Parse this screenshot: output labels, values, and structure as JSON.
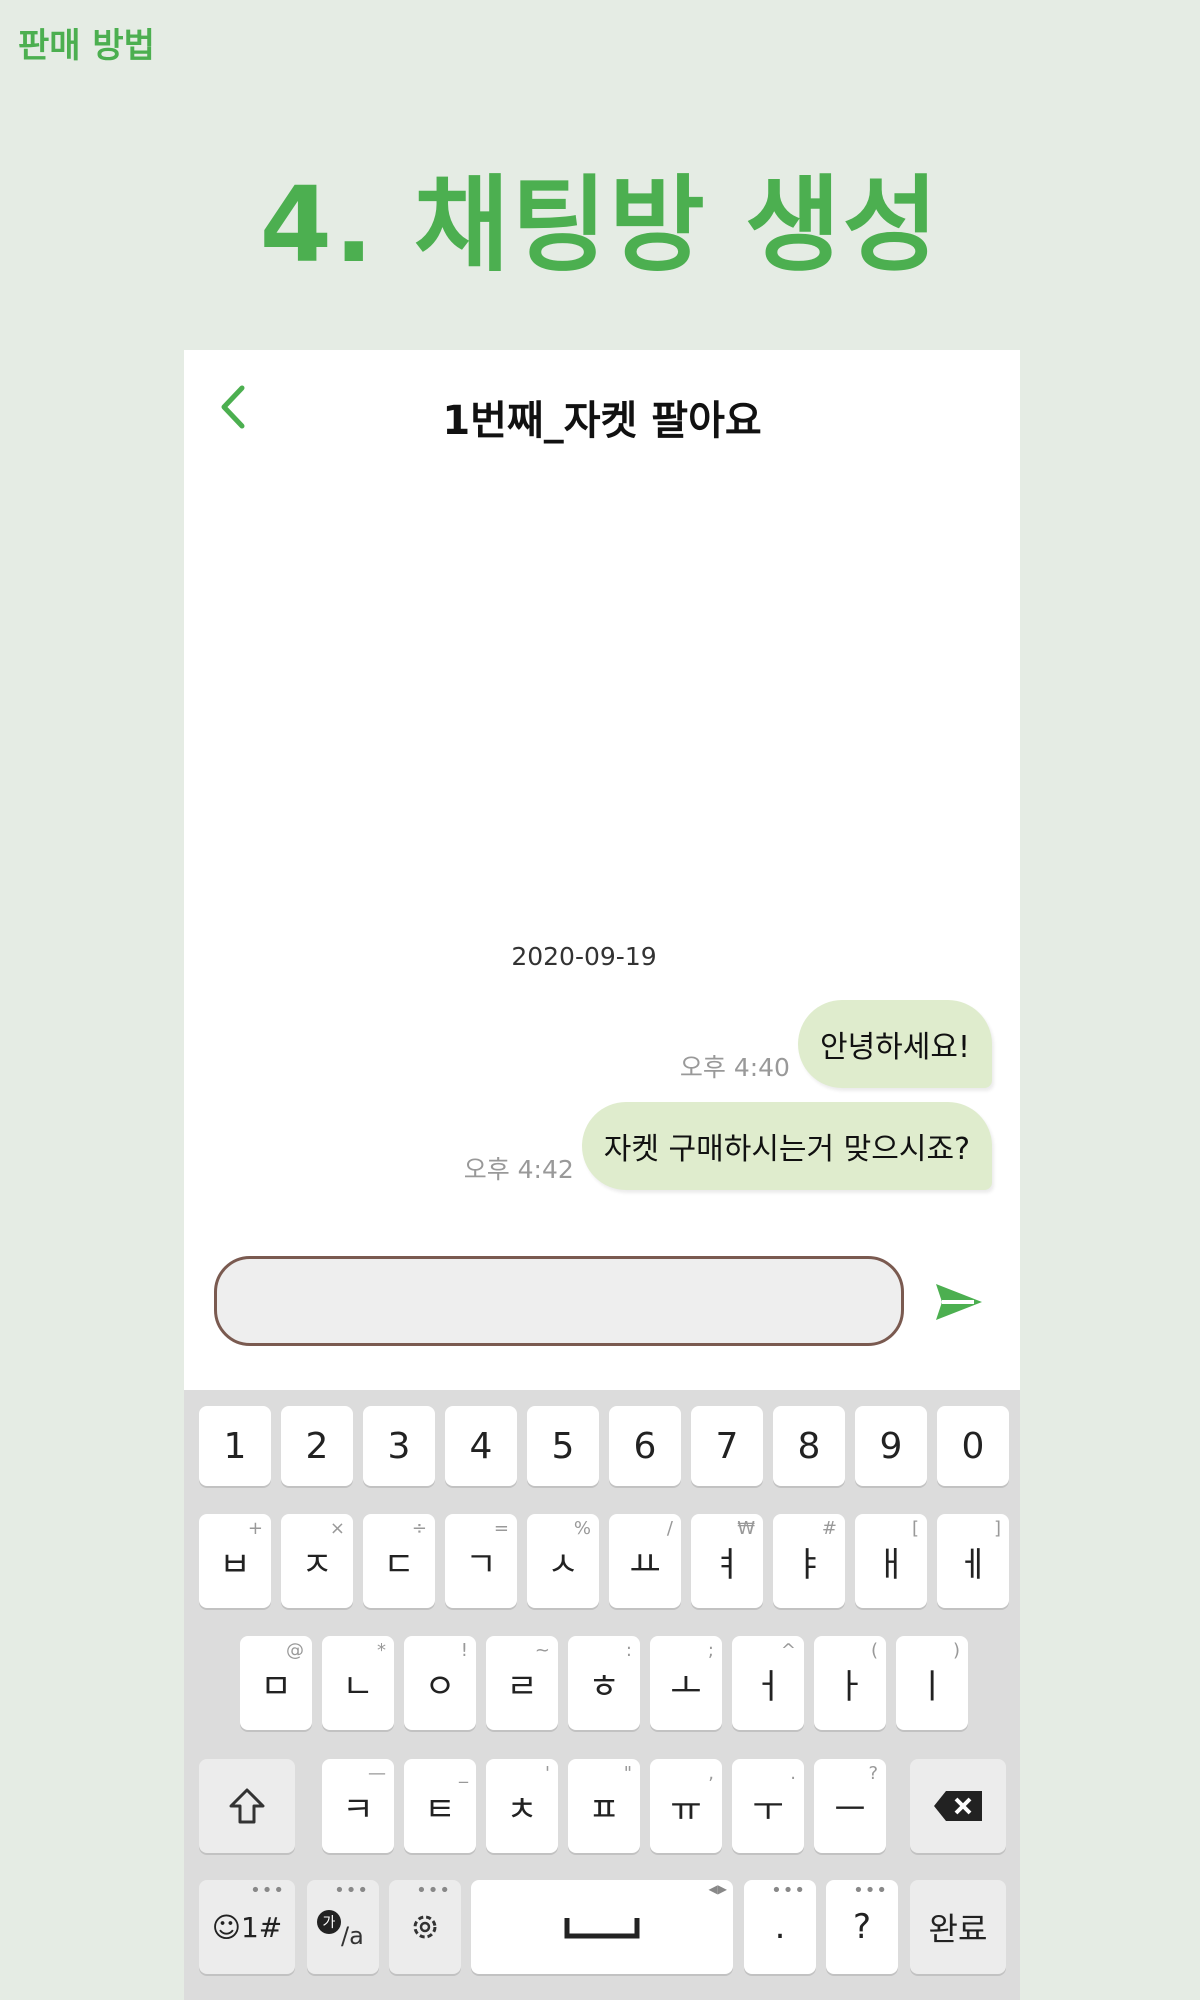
{
  "page": {
    "corner_title": "판매 방법",
    "main_title": "4. 채팅방 생성"
  },
  "chat": {
    "title": "1번째_자켓 팔아요",
    "date": "2020-09-19",
    "messages": [
      {
        "text": "안녕하세요!",
        "time": "오후 4:40"
      },
      {
        "text": "자켓 구매하시는거 맞으시죠?",
        "time": "오후 4:42"
      }
    ],
    "input_value": ""
  },
  "keyboard": {
    "row1": [
      "1",
      "2",
      "3",
      "4",
      "5",
      "6",
      "7",
      "8",
      "9",
      "0"
    ],
    "row2": [
      {
        "key": "ㅂ",
        "sub": "+"
      },
      {
        "key": "ㅈ",
        "sub": "×"
      },
      {
        "key": "ㄷ",
        "sub": "÷"
      },
      {
        "key": "ㄱ",
        "sub": "="
      },
      {
        "key": "ㅅ",
        "sub": "%"
      },
      {
        "key": "ㅛ",
        "sub": "/"
      },
      {
        "key": "ㅕ",
        "sub": "₩"
      },
      {
        "key": "ㅑ",
        "sub": "#"
      },
      {
        "key": "ㅐ",
        "sub": "["
      },
      {
        "key": "ㅔ",
        "sub": "]"
      }
    ],
    "row3": [
      {
        "key": "ㅁ",
        "sub": "@"
      },
      {
        "key": "ㄴ",
        "sub": "*"
      },
      {
        "key": "ㅇ",
        "sub": "!"
      },
      {
        "key": "ㄹ",
        "sub": "~"
      },
      {
        "key": "ㅎ",
        "sub": ":"
      },
      {
        "key": "ㅗ",
        "sub": ";"
      },
      {
        "key": "ㅓ",
        "sub": "^"
      },
      {
        "key": "ㅏ",
        "sub": "("
      },
      {
        "key": "ㅣ",
        "sub": ")"
      }
    ],
    "row4": [
      {
        "key": "ㅋ",
        "sub": "—"
      },
      {
        "key": "ㅌ",
        "sub": "_"
      },
      {
        "key": "ㅊ",
        "sub": "'"
      },
      {
        "key": "ㅍ",
        "sub": "\""
      },
      {
        "key": "ㅠ",
        "sub": ","
      },
      {
        "key": "ㅜ",
        "sub": "."
      },
      {
        "key": "ㅡ",
        "sub": "?"
      }
    ],
    "bottom": {
      "emoji": "☺1#",
      "lang_top": "가",
      "lang_bottom": "/a",
      "period": ".",
      "question": "?",
      "done": "완료"
    },
    "icons": {
      "shift": "shift-icon",
      "backspace": "backspace-icon",
      "settings": "gear-icon",
      "space": "space-icon"
    }
  },
  "colors": {
    "accent": "#4caf50",
    "bubble": "#dfeccd",
    "background": "#e5ece4"
  }
}
